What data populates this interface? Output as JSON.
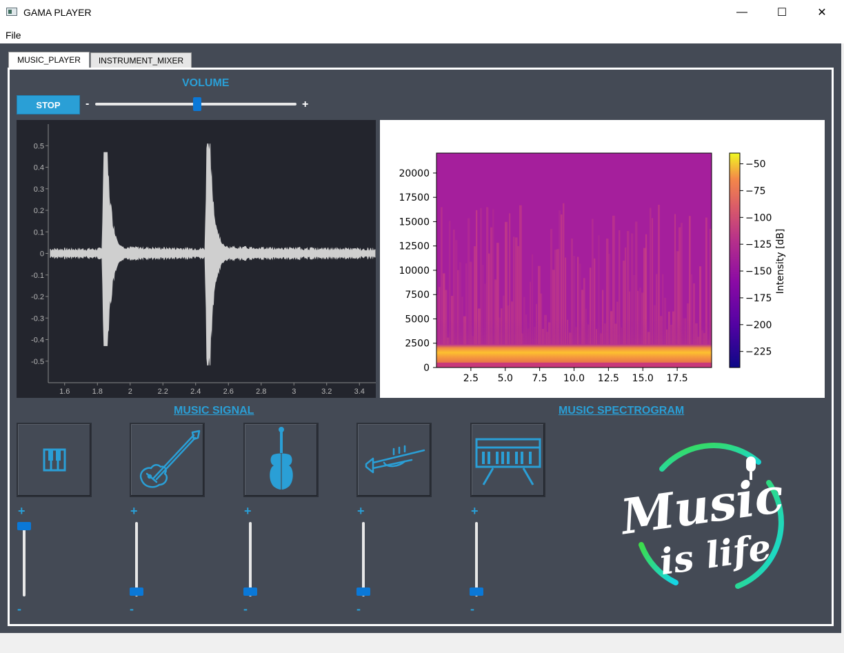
{
  "window": {
    "title": "GAMA PLAYER",
    "minimize": "—",
    "maximize": "☐",
    "close": "✕"
  },
  "menu": {
    "file": "File"
  },
  "tabs": [
    {
      "label": "MUSIC_PLAYER",
      "active": true
    },
    {
      "label": "INSTRUMENT_MIXER",
      "active": false
    }
  ],
  "controls": {
    "volume_label": "VOLUME",
    "stop_label": "STOP",
    "minus": "-",
    "plus": "+",
    "volume_level": 0.5
  },
  "captions": {
    "signal": "MUSIC SIGNAL",
    "spectrogram": "MUSIC SPECTROGRAM"
  },
  "instruments": [
    {
      "name": "piano",
      "icon": "piano-icon",
      "level": 1.0
    },
    {
      "name": "guitar",
      "icon": "guitar-icon",
      "level": 0.0
    },
    {
      "name": "violin",
      "icon": "violin-icon",
      "level": 0.0
    },
    {
      "name": "trumpet",
      "icon": "trumpet-icon",
      "level": 0.0
    },
    {
      "name": "keyboard",
      "icon": "keyboard-icon",
      "level": 0.0
    }
  ],
  "slider_labels": {
    "plus": "+",
    "minus": "-"
  },
  "logo": {
    "text_main": "Music",
    "text_sub": "is life"
  },
  "colors": {
    "accent": "#2a9fd6",
    "background": "#444a55",
    "handle": "#0a78d7"
  },
  "chart_data": [
    {
      "type": "line",
      "x_ticks": [
        "1.6",
        "1.8",
        "2",
        "2.2",
        "2.4",
        "2.6",
        "2.8",
        "3",
        "3.2",
        "3.4"
      ],
      "y_ticks": [
        "0.5",
        "0.4",
        "0.3",
        "0.2",
        "0.1",
        "0",
        "-0.1",
        "-0.2",
        "-0.3",
        "-0.4",
        "-0.5"
      ],
      "xlim": [
        1.5,
        3.5
      ],
      "ylim": [
        -0.6,
        0.6
      ],
      "bursts": [
        {
          "t": 1.84,
          "peak": 0.47,
          "trough": -0.43
        },
        {
          "t": 2.47,
          "peak": 0.51,
          "trough": -0.52
        }
      ],
      "baseline_amplitude": 0.02,
      "grid": false
    },
    {
      "type": "heatmap",
      "x_ticks": [
        "2.5",
        "5.0",
        "7.5",
        "10.0",
        "12.5",
        "15.0",
        "17.5"
      ],
      "y_ticks": [
        "0",
        "2500",
        "5000",
        "7500",
        "10000",
        "12500",
        "15000",
        "17500",
        "20000"
      ],
      "xlim": [
        0,
        20
      ],
      "ylim": [
        0,
        22050
      ],
      "colorbar": {
        "label": "Intensity [dB]",
        "ticks": [
          "-50",
          "-75",
          "-100",
          "-125",
          "-150",
          "-175",
          "-200",
          "-225"
        ],
        "range": [
          -240,
          -40
        ]
      },
      "colormap": "plasma"
    }
  ]
}
